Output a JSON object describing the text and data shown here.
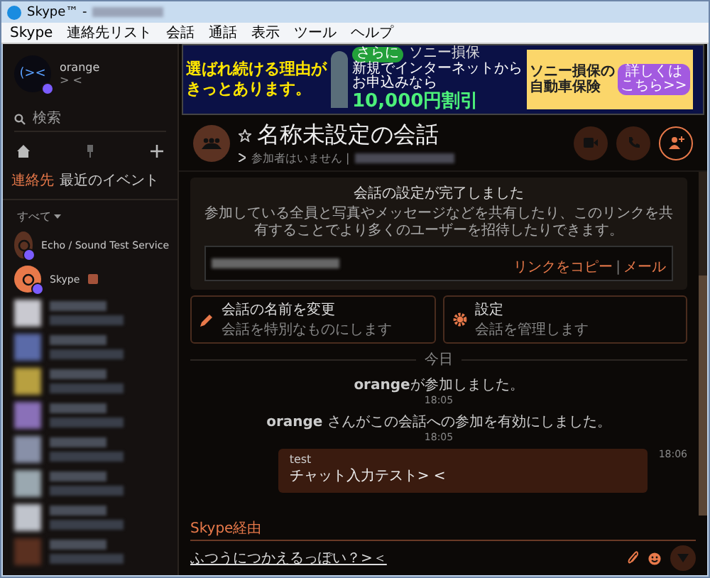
{
  "window": {
    "title": "Skype™ -"
  },
  "menu": [
    "Skype",
    "連絡先リスト",
    "会話",
    "通話",
    "表示",
    "ツール",
    "ヘルプ"
  ],
  "profile": {
    "avatar_text": "(><",
    "name": "orange",
    "mood": "> <"
  },
  "search": {
    "placeholder": "検索"
  },
  "tabs": [
    {
      "label": "連絡先",
      "selected": true
    },
    {
      "label": "最近のイベント",
      "selected": false
    }
  ],
  "filter": "すべて",
  "contacts": [
    {
      "name": "Echo / Sound Test Service",
      "kind": "echo",
      "verified": true
    },
    {
      "name": "Skype",
      "kind": "skype",
      "verified": true
    },
    {
      "kind": "blurred",
      "color": "#c9c9d0"
    },
    {
      "kind": "blurred",
      "color": "#5a6aa8"
    },
    {
      "kind": "blurred",
      "color": "#b8a040"
    },
    {
      "kind": "blurred",
      "color": "#8a70b8"
    },
    {
      "kind": "blurred",
      "color": "#8890a8"
    },
    {
      "kind": "blurred",
      "color": "#9aa8b0"
    },
    {
      "kind": "blurred",
      "color": "#c0c4cc"
    },
    {
      "kind": "blurred",
      "color": "#5a3020"
    }
  ],
  "ad": {
    "headline": [
      "選ばれ続ける理由が",
      "きっとあります。"
    ],
    "badge": "さらに",
    "lines": [
      "新規でインターネットから",
      "お申込みなら"
    ],
    "offer": "10,000円割引",
    "logo": "ソニー損保",
    "product": [
      "ソニー損保の",
      "自動車保険"
    ],
    "cta": [
      "詳しくは",
      "こちら>>"
    ]
  },
  "conversation": {
    "title": "名称未設定の会話",
    "subtitle": "参加者はいません |"
  },
  "setup": {
    "title": "会話の設定が完了しました",
    "description": "参加している全員と写真やメッセージなどを共有したり、このリンクを共有することでより多くのユーザーを招待したりできます。",
    "copy_link": "リンクをコピー",
    "separator": "|",
    "mail": "メール"
  },
  "actions": [
    {
      "kind": "rename",
      "title": "会話の名前を変更",
      "subtitle": "会話を特別なものにします"
    },
    {
      "kind": "settings",
      "title": "設定",
      "subtitle": "会話を管理します"
    }
  ],
  "day": "今日",
  "events": [
    {
      "user": "orange",
      "text": "が参加しました。",
      "time": "18:05"
    },
    {
      "user": "orange",
      "text": " さんがこの会話への参加を有効にしました。",
      "time": "18:05"
    }
  ],
  "messages": [
    {
      "sender": "test",
      "text": "チャット入力テスト> <",
      "time": "18:06"
    }
  ],
  "composer": {
    "via": "Skype経由",
    "value": "ふつうにつかえるっぽい？>＜"
  }
}
